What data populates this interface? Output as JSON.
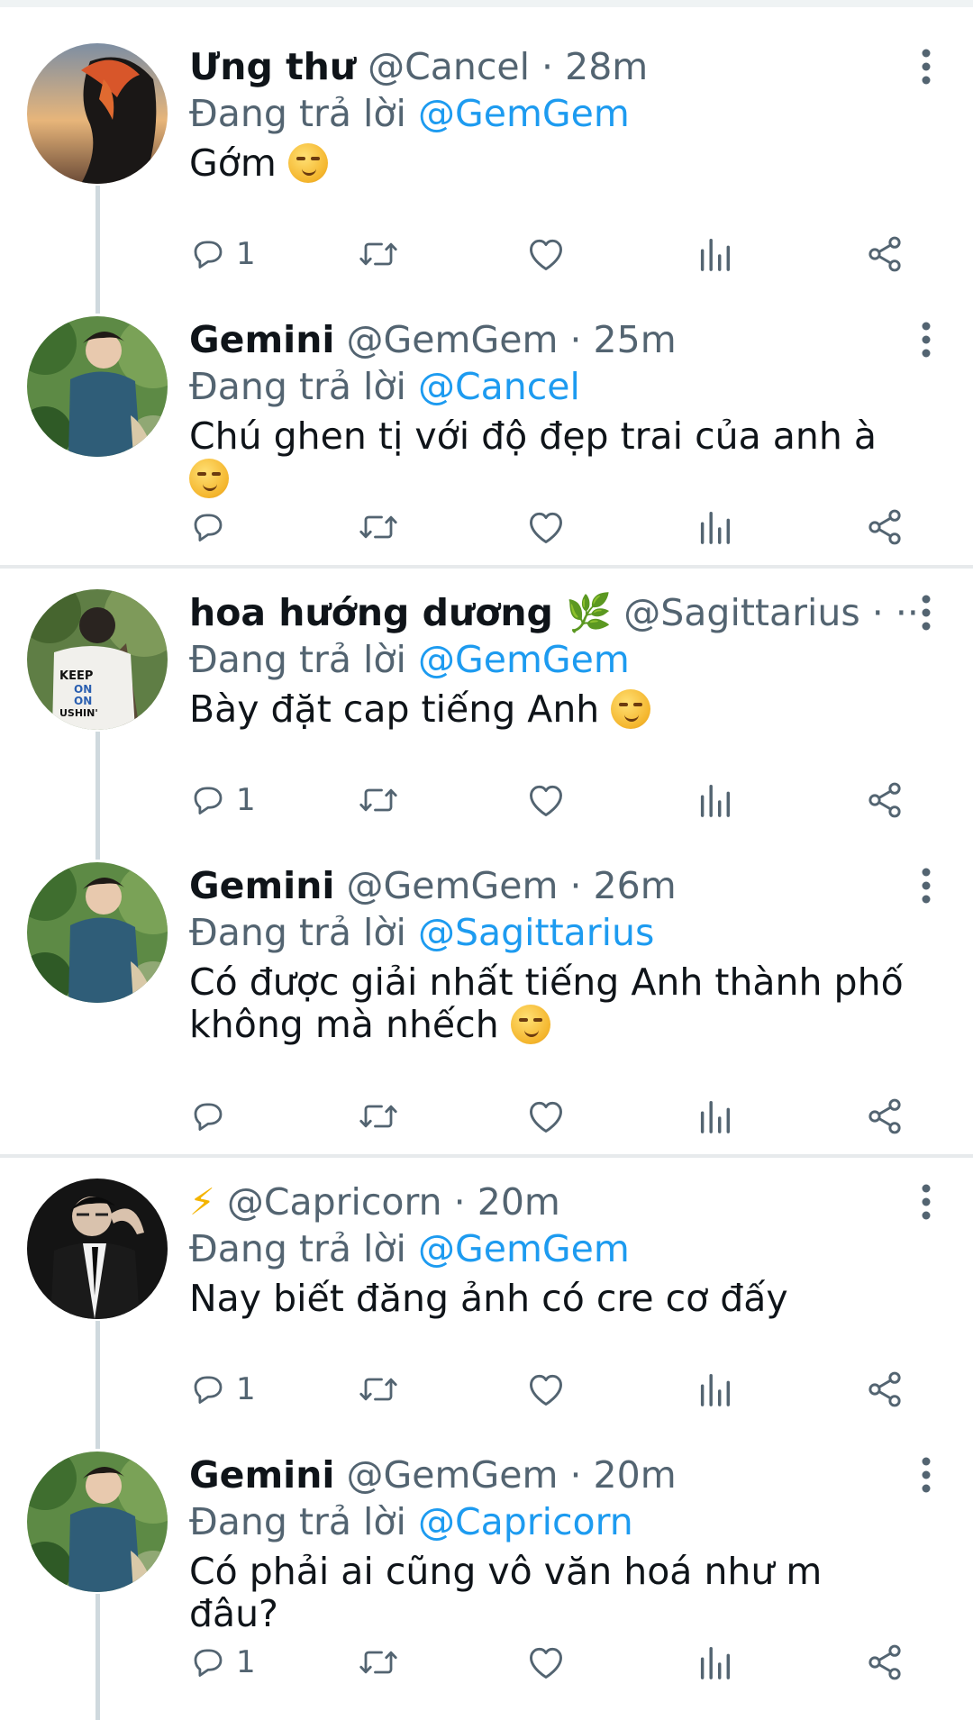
{
  "tweets": [
    {
      "name": "Ưng thư",
      "handle": "@Cancel",
      "time": "28m",
      "reply_prefix": "Đang trả lời",
      "reply_to": "@GemGem",
      "text": "Gớm",
      "emoji": "smirk-emoji",
      "reply_count": "1",
      "avatar": "sunset-orange-hair-avatar"
    },
    {
      "name": "Gemini",
      "handle": "@GemGem",
      "time": "25m",
      "reply_prefix": "Đang trả lời",
      "reply_to": "@Cancel",
      "text": "Chú ghen tị với độ đẹp trai của anh à",
      "emoji": "smirk-emoji",
      "reply_count": "",
      "avatar": "garden-blue-shirt-avatar"
    },
    {
      "name": "hoa hướng dương 🌿",
      "handle": "@Sagittarius",
      "time": "· ···",
      "reply_prefix": "Đang trả lời",
      "reply_to": "@GemGem",
      "text": "Bày đặt cap tiếng Anh",
      "emoji": "smirk-emoji",
      "reply_count": "1",
      "avatar": "keep-on-shirt-avatar"
    },
    {
      "name": "Gemini",
      "handle": "@GemGem",
      "time": "26m",
      "reply_prefix": "Đang trả lời",
      "reply_to": "@Sagittarius",
      "text": "Có được giải nhất tiếng Anh thành phố không mà nhếch",
      "emoji": "raised-eyebrow-emoji",
      "reply_count": "",
      "avatar": "garden-blue-shirt-avatar"
    },
    {
      "name": "⚡",
      "handle": "@Capricorn",
      "time": "20m",
      "reply_prefix": "Đang trả lời",
      "reply_to": "@GemGem",
      "text": "Nay biết đăng ảnh có cre cơ đấy",
      "emoji": "",
      "reply_count": "1",
      "avatar": "black-suit-avatar"
    },
    {
      "name": "Gemini",
      "handle": "@GemGem",
      "time": "20m",
      "reply_prefix": "Đang trả lời",
      "reply_to": "@Capricorn",
      "text": "Có phải ai cũng vô văn hoá như m đâu?",
      "emoji": "",
      "reply_count": "1",
      "avatar": "garden-blue-shirt-avatar"
    }
  ],
  "icons": {
    "reply": "reply-icon",
    "retweet": "retweet-icon",
    "like": "heart-icon",
    "views": "views-bar-icon",
    "share": "share-icon",
    "more": "more-vertical-icon"
  },
  "colors": {
    "mention": "#1d9bf0",
    "secondary_text": "#536471",
    "primary_text": "#0f1419",
    "thread_line": "#cfd9de"
  }
}
